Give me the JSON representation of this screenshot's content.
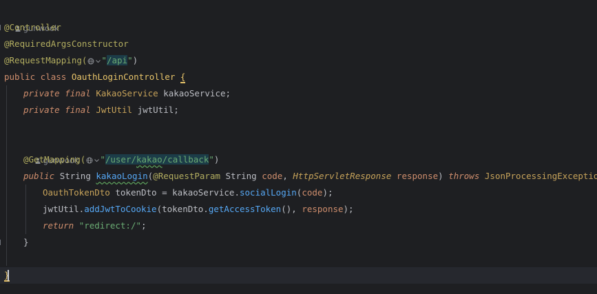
{
  "editor": {
    "author1": "gunwook",
    "author2": "gunwook",
    "l_controller": "@Controller",
    "l_reqargs": "@RequiredArgsConstructor",
    "l_reqmap_anno": "@RequestMapping(",
    "l_reqmap_q1": "\"",
    "l_reqmap_str": "/api",
    "l_reqmap_q2": "\"",
    "l_reqmap_close": ")",
    "l_class_kw": "public class ",
    "l_class_name": "OauthLoginController",
    "l_class_brace": "{",
    "f1_mods": "private final ",
    "f1_type": "KakaoService",
    "f1_name": " kakaoService;",
    "f2_mods": "private final ",
    "f2_type": "JwtUtil",
    "f2_name": " jwtUtil;",
    "get_anno": "@GetMapping(",
    "get_q1": "\"",
    "get_str1": "/user/",
    "get_str2": "kakao",
    "get_str3": "/callback",
    "get_q2": "\"",
    "get_close": ")",
    "m_public": "public ",
    "m_type": "String ",
    "m_name": "kakaoLogin",
    "m_open": "(",
    "m_anno": "@RequestParam ",
    "m_ptype1": "String ",
    "m_p1": "code",
    "m_comma": ", ",
    "m_ptype2": "HttpServletResponse",
    "m_sp": " ",
    "m_p2": "response",
    "m_close": ") ",
    "m_throws": "throws ",
    "m_exc": "JsonProcessingException",
    "m_brace": "{",
    "s1_type": "OauthTokenDto",
    "s1_a": " tokenDto = kakaoService.",
    "s1_call": "socialLogin",
    "s1_b": "(",
    "s1_p": "code",
    "s1_c": ");",
    "s2_a": "jwtUtil.",
    "s2_call": "addJwtToCookie",
    "s2_b": "(tokenDto.",
    "s2_call2": "getAccessToken",
    "s2_c": "(), ",
    "s2_p": "response",
    "s2_d": ");",
    "s3_kw": "return ",
    "s3_str": "\"redirect:/\"",
    "s3_end": ";",
    "m_end": "}",
    "class_end": "}"
  },
  "icons": {
    "globe": "globe-icon",
    "chevron": "chevron-down-icon",
    "person": "person-icon"
  },
  "colors": {
    "background": "#1e1f22",
    "annotation": "#b3ae60",
    "keyword": "#cf8e6d",
    "string": "#6aab73",
    "method": "#56a8f5",
    "parameter": "#c77dbb",
    "text": "#bcbec4"
  }
}
